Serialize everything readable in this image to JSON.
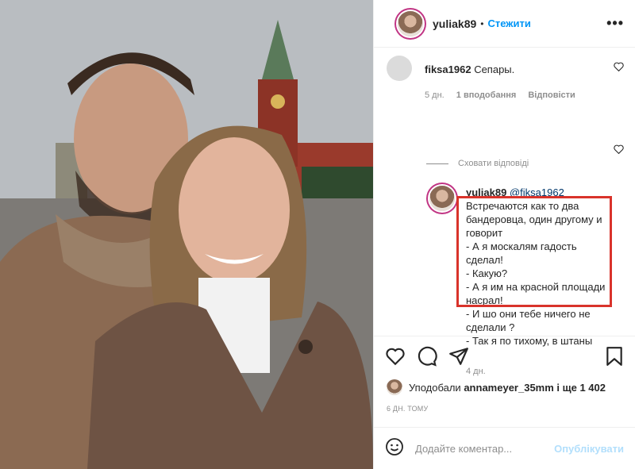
{
  "header": {
    "username": "yuliak89",
    "separator": "•",
    "follow_label": "Стежити",
    "more_label": "•••"
  },
  "comment1": {
    "username": "fiksa1962",
    "text": "Сепары.",
    "time": "5 дн.",
    "likes": "1 вподобання",
    "reply_label": "Відповісти"
  },
  "hide_replies_label": "Сховати відповіді",
  "comment2": {
    "username": "yuliak89",
    "mention": "@fiksa1962",
    "text": "Встречаются как то два бандеровца, один другому и говорит\n- А я москалям гадость сделал!\n- Какую?\n- А я им на красной площади насрал!\n- И шо они тебе ничего не сделали ?\n- Так я по тихому, в штаны",
    "time": "4 дн."
  },
  "likes": {
    "prefix": "Уподобали",
    "user": "annameyer_35mm",
    "suffix": "і ще 1 402"
  },
  "timestamp": "6 ДН. ТОМУ",
  "add_comment": {
    "placeholder": "Додайте коментар...",
    "post_label": "Опублікувати"
  },
  "icons": [
    "heart-icon",
    "comment-icon",
    "share-icon",
    "bookmark-icon",
    "emoji-icon"
  ]
}
